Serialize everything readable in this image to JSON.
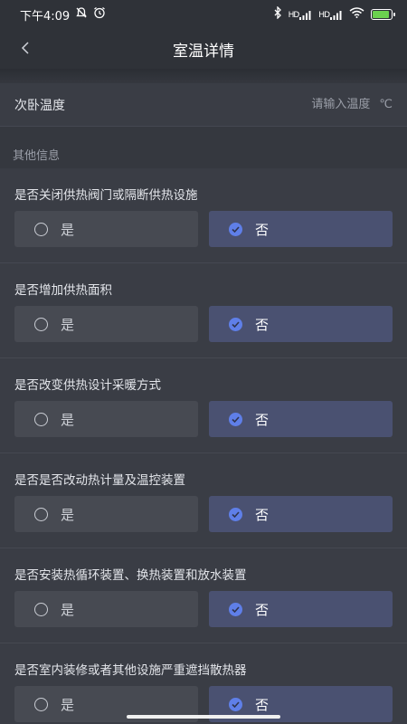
{
  "status_bar": {
    "time": "下午4:09",
    "signal1": "HD",
    "signal2": "HD",
    "icons": [
      "mute-icon",
      "alarm-icon",
      "bluetooth-icon",
      "signal-icon",
      "signal-icon",
      "wifi-icon",
      "battery-charging-icon"
    ]
  },
  "header": {
    "title": "室温详情",
    "back_icon": "chevron-left-icon"
  },
  "temperature": {
    "label": "次卧温度",
    "placeholder": "请输入温度",
    "unit": "℃"
  },
  "section": {
    "title": "其他信息"
  },
  "questions": [
    {
      "text": "是否关闭供热阀门或隔断供热设施",
      "yes": "是",
      "no": "否",
      "selected": "no"
    },
    {
      "text": "是否增加供热面积",
      "yes": "是",
      "no": "否",
      "selected": "no"
    },
    {
      "text": "是否改变供热设计采暖方式",
      "yes": "是",
      "no": "否",
      "selected": "no"
    },
    {
      "text": "是否是否改动热计量及温控装置",
      "yes": "是",
      "no": "否",
      "selected": "no"
    },
    {
      "text": "是否安装热循环装置、换热装置和放水装置",
      "yes": "是",
      "no": "否",
      "selected": "no"
    },
    {
      "text": "是否室内装修或者其他设施严重遮挡散热器",
      "yes": "是",
      "no": "否",
      "selected": "no"
    }
  ],
  "colors": {
    "background": "#35383f",
    "card": "#3a3d45",
    "selected_option": "#4a5171",
    "unselected_option": "#474a52",
    "accent": "#5f7fe8"
  }
}
